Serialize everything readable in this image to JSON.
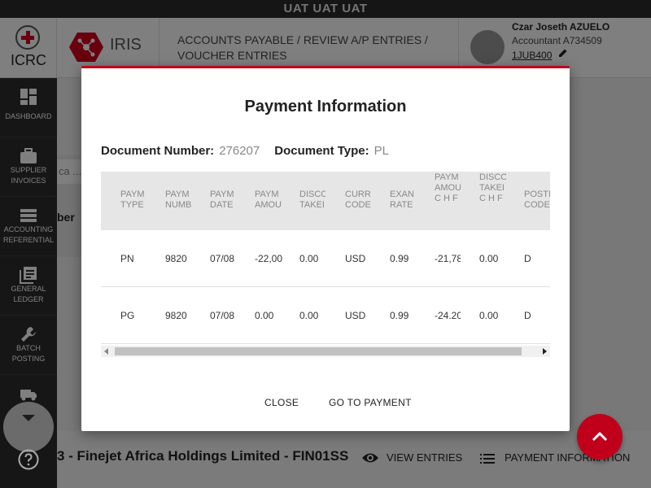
{
  "env_banner": "UAT UAT UAT",
  "header": {
    "org_name": "ICRC",
    "app_name": "IRIS",
    "breadcrumb": "ACCOUNTS PAYABLE / REVIEW A/P ENTRIES / VOUCHER ENTRIES",
    "user": {
      "name": "Czar Joseth AZUELO",
      "role": "Accountant A734509",
      "link": "1JUB400"
    }
  },
  "sidebar": {
    "items": [
      {
        "label": "DASHBOARD",
        "icon": "dashboard-icon"
      },
      {
        "label": "SUPPLIER INVOICES",
        "icon": "briefcase-icon"
      },
      {
        "label": "ACCOUNTING REFERENTIAL",
        "icon": "list-icon"
      },
      {
        "label": "GENERAL LEDGER",
        "icon": "ledger-icon"
      },
      {
        "label": "BATCH POSTING",
        "icon": "wrench-icon"
      }
    ]
  },
  "background": {
    "input_value": "ca ...",
    "label": "ber",
    "doc_title": "3 - Finejet Africa Holdings Limited - FIN01SS",
    "view_entries": "VIEW ENTRIES",
    "payment_information": "PAYMENT INFORMATION"
  },
  "modal": {
    "title": "Payment Information",
    "doc_number_label": "Document Number:",
    "doc_number_value": "276207",
    "doc_type_label": "Document Type:",
    "doc_type_value": "PL",
    "columns": [
      "PAYM TYPE",
      "PAYM NUMB",
      "PAYM DATE",
      "PAYM AMOU",
      "DISCO TAKEI",
      "CURR CODE",
      "EXAN RATE",
      "PAYM AMOU C H F",
      "DISCO TAKEI C H F",
      "POSTI CODE"
    ],
    "rows": [
      [
        "PN",
        "9820",
        "07/08",
        "-22,00",
        "0.00",
        "USD",
        "0.99",
        "-21,78",
        "0.00",
        "D"
      ],
      [
        "PG",
        "9820",
        "07/08",
        "0.00",
        "0.00",
        "USD",
        "0.99",
        "-24.20",
        "0.00",
        "D"
      ]
    ],
    "close_label": "CLOSE",
    "goto_label": "GO TO PAYMENT"
  },
  "colors": {
    "accent": "#c0001b",
    "sidebar_bg": "#2d2d2d"
  }
}
